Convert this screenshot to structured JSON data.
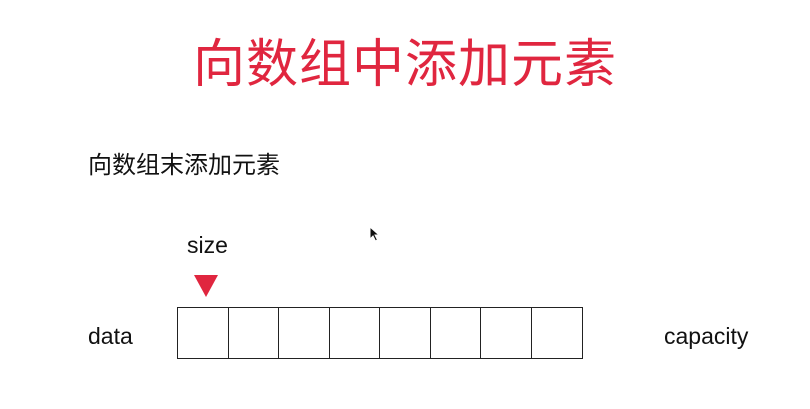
{
  "title": "向数组中添加元素",
  "subtitle": "向数组末添加元素",
  "diagram": {
    "pointer_label": "size",
    "array_label": "data",
    "capacity_label": "capacity",
    "cell_count": 8,
    "pointer_index": 0
  },
  "colors": {
    "accent": "#e0263f",
    "text": "#111111",
    "border": "#222222"
  },
  "icons": {
    "pointer": "down-triangle-icon",
    "cursor": "mouse-cursor-icon"
  }
}
